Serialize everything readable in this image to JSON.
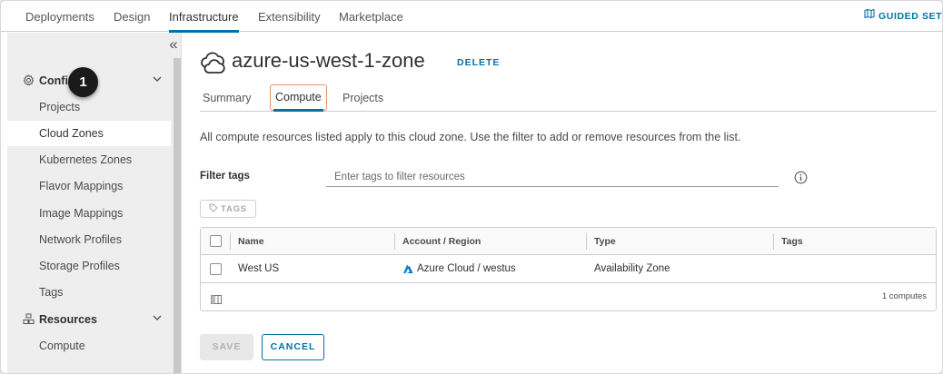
{
  "top_nav": {
    "tabs": [
      {
        "label": "Deployments"
      },
      {
        "label": "Design"
      },
      {
        "label": "Infrastructure"
      },
      {
        "label": "Extensibility"
      },
      {
        "label": "Marketplace"
      }
    ],
    "active_tab": "Infrastructure",
    "guided_setup_label": "GUIDED SETU"
  },
  "sidebar": {
    "collapse_icon": "double-chevron-left-icon",
    "groups": [
      {
        "label": "Confi",
        "icon": "gear-icon"
      },
      {
        "label": "Resources",
        "icon": "resources-icon"
      }
    ],
    "items": [
      {
        "label": "Projects"
      },
      {
        "label": "Cloud Zones"
      },
      {
        "label": "Kubernetes Zones"
      },
      {
        "label": "Flavor Mappings"
      },
      {
        "label": "Image Mappings"
      },
      {
        "label": "Network Profiles"
      },
      {
        "label": "Storage Profiles"
      },
      {
        "label": "Tags"
      }
    ],
    "resource_items": [
      {
        "label": "Compute"
      }
    ],
    "active_item": "Cloud Zones"
  },
  "callout": {
    "number": "1"
  },
  "page": {
    "title": "azure-us-west-1-zone",
    "title_icon": "cloud-zone-icon",
    "delete_label": "DELETE",
    "subtabs": [
      {
        "label": "Summary"
      },
      {
        "label": "Compute"
      },
      {
        "label": "Projects"
      }
    ],
    "active_subtab": "Compute",
    "description": "All compute resources listed apply to this cloud zone. Use the filter to add or remove resources from the list.",
    "filter": {
      "label": "Filter tags",
      "placeholder": "Enter tags to filter resources",
      "value": ""
    },
    "tags_button_label": "TAGS",
    "grid": {
      "columns": [
        "Name",
        "Account / Region",
        "Type",
        "Tags"
      ],
      "rows": [
        {
          "name": "West US",
          "account_region": "Azure Cloud / westus",
          "type": "Availability Zone",
          "tags": ""
        }
      ],
      "footer_count": "1 computes"
    },
    "save_label": "SAVE",
    "cancel_label": "CANCEL"
  },
  "colors": {
    "accent": "#0072a3",
    "azure_blue": "#0089d6",
    "active_tab_outline": "#e88f6f"
  }
}
